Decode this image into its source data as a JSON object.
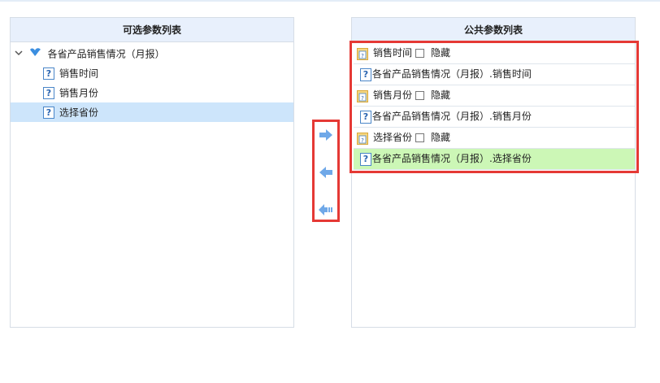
{
  "left_panel": {
    "title": "可选参数列表",
    "tree": {
      "root_label": "各省产品销售情况（月报）",
      "children": [
        {
          "label": "销售时间",
          "selected": false
        },
        {
          "label": "销售月份",
          "selected": false
        },
        {
          "label": "选择省份",
          "selected": true
        }
      ]
    }
  },
  "transfer_buttons": [
    "arrow-right-icon",
    "arrow-left-icon",
    "arrow-left-all-icon"
  ],
  "right_panel": {
    "title": "公共参数列表",
    "hide_label": "隐藏",
    "rows": [
      {
        "name": "销售时间",
        "path": "各省产品销售情况（月报）.销售时间"
      },
      {
        "name": "销售月份",
        "path": "各省产品销售情况（月报）.销售月份"
      },
      {
        "name": "选择省份",
        "path": "各省产品销售情况（月报）.选择省份"
      }
    ]
  },
  "colors": {
    "header_bg": "#e8f0fc",
    "selected_bg": "#cde5fb",
    "highlight_bg": "#ccf7b6",
    "highlight_border": "#e53935",
    "arrow": "#6fa8e8"
  }
}
